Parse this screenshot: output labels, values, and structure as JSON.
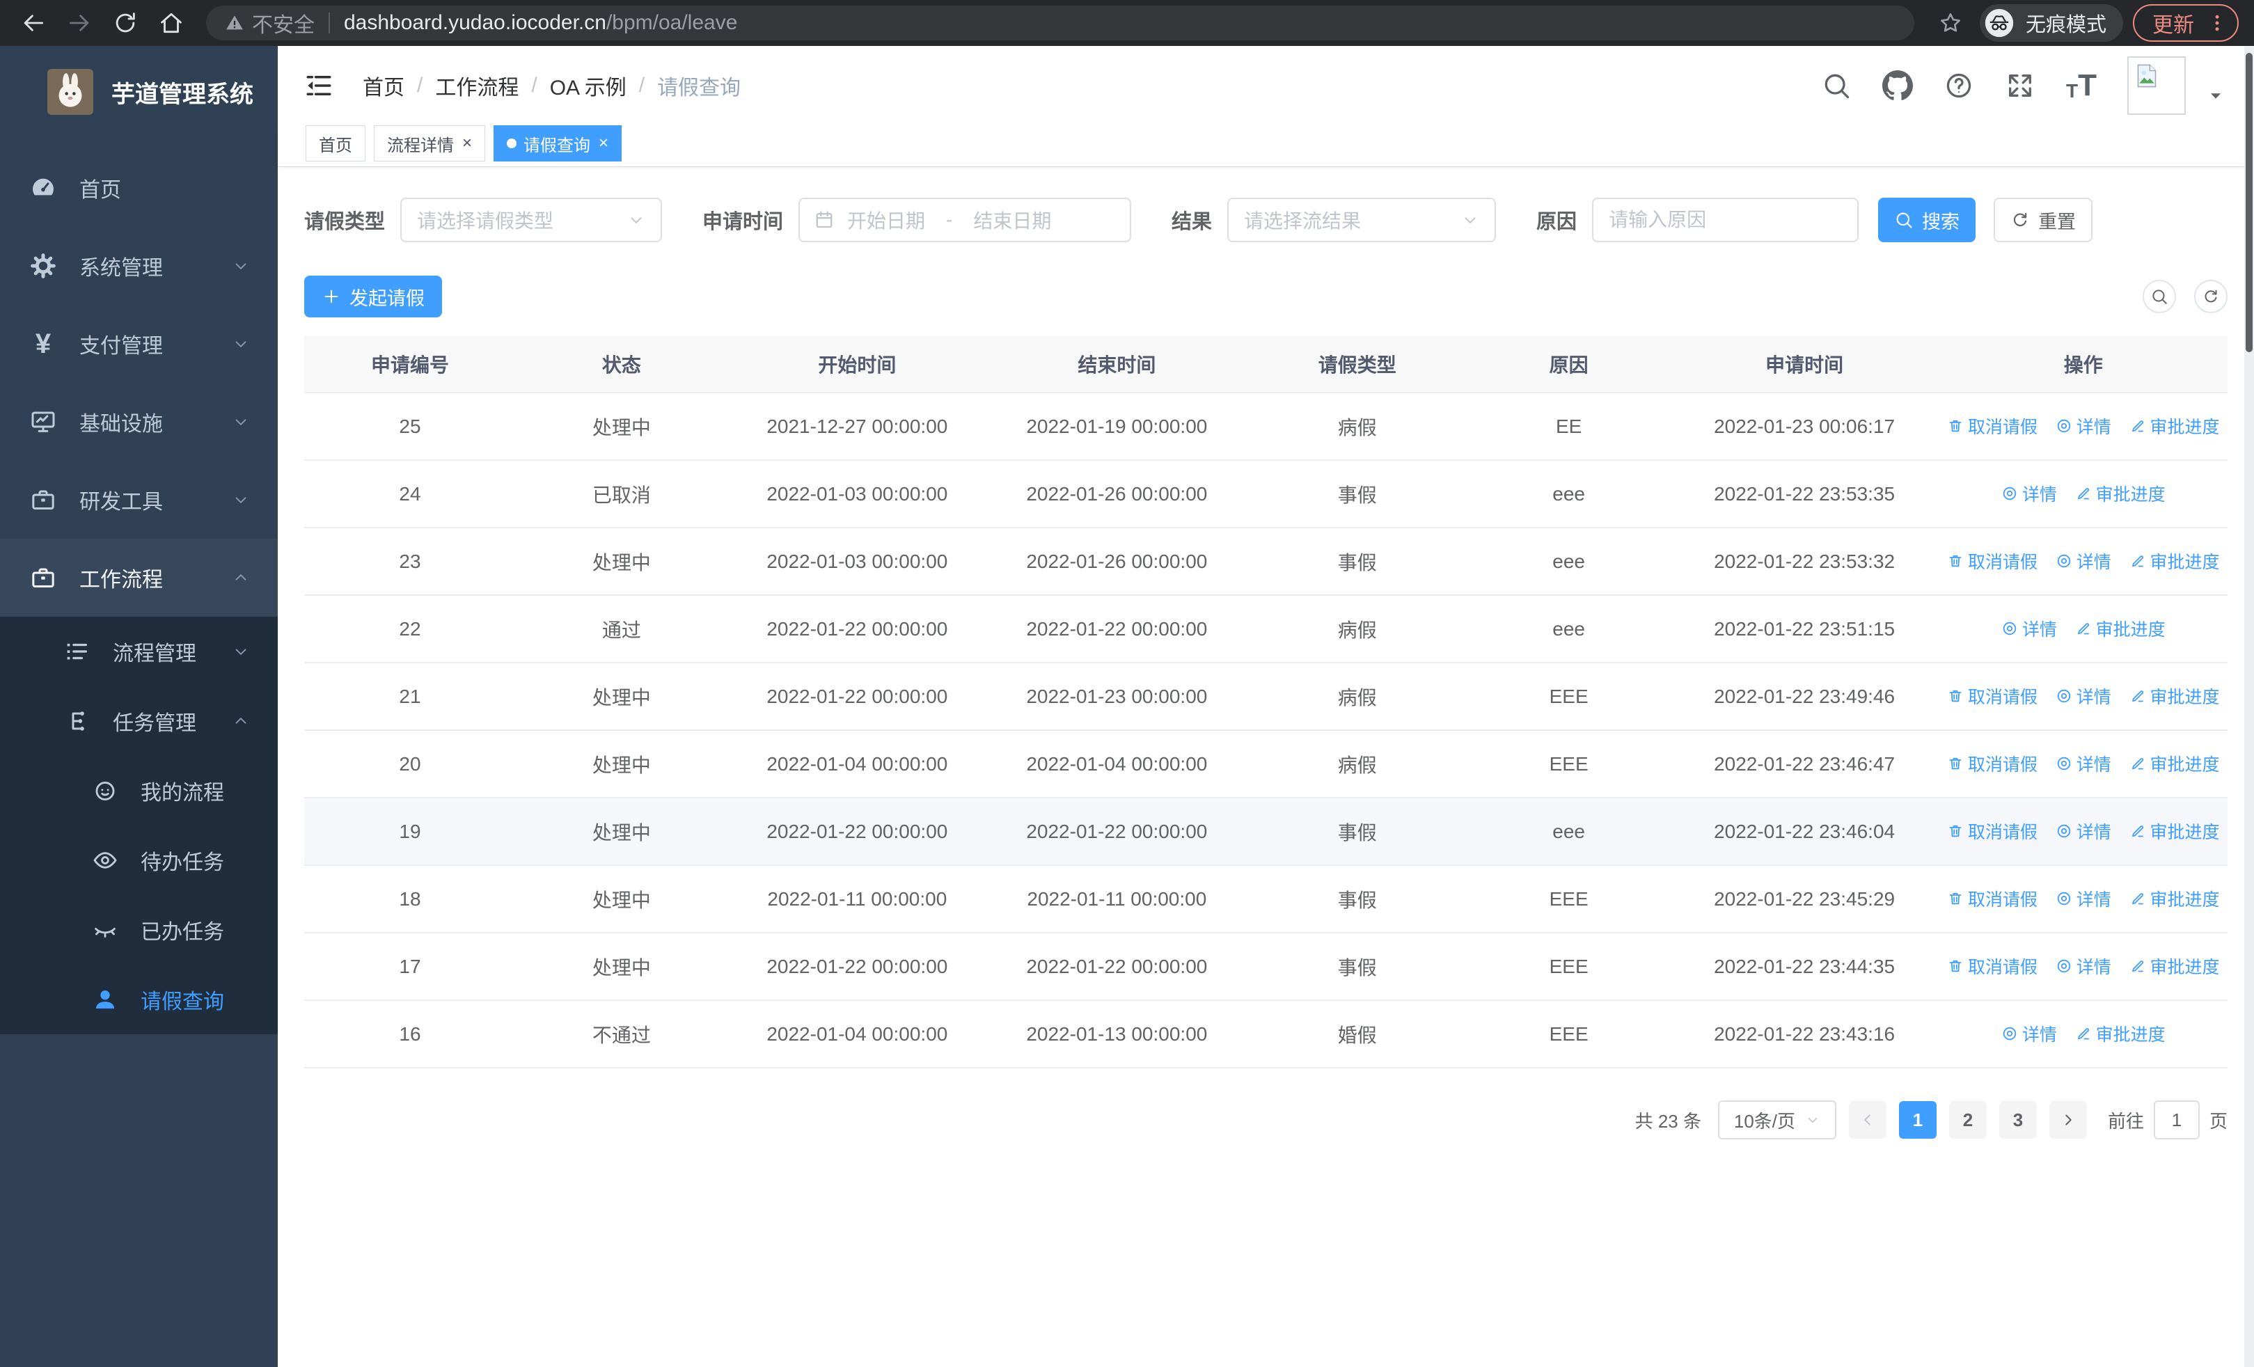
{
  "colors": {
    "accent": "#409eff",
    "sidebar_bg": "#304156",
    "submenu_bg": "#1f2d3d",
    "update_accent": "#ec8b82"
  },
  "browser": {
    "security_label": "不安全",
    "url_host": "dashboard.yudao.iocoder.cn",
    "url_path": "/bpm/oa/leave",
    "incognito_label": "无痕模式",
    "update_label": "更新"
  },
  "sidebar": {
    "title": "芋道管理系统",
    "items": [
      {
        "key": "home",
        "label": "首页",
        "icon": "dashboard",
        "level": 0,
        "chevron": null,
        "in_submenu": false,
        "open": false,
        "active": false
      },
      {
        "key": "system-mgmt",
        "label": "系统管理",
        "icon": "gear",
        "level": 0,
        "chevron": "down",
        "in_submenu": false,
        "open": false,
        "active": false
      },
      {
        "key": "payment-mgmt",
        "label": "支付管理",
        "icon": "yen",
        "level": 0,
        "chevron": "down",
        "in_submenu": false,
        "open": false,
        "active": false
      },
      {
        "key": "infrastructure",
        "label": "基础设施",
        "icon": "monitor",
        "level": 0,
        "chevron": "down",
        "in_submenu": false,
        "open": false,
        "active": false
      },
      {
        "key": "dev-tools",
        "label": "研发工具",
        "icon": "toolbox",
        "level": 0,
        "chevron": "down",
        "in_submenu": false,
        "open": false,
        "active": false
      },
      {
        "key": "workflow",
        "label": "工作流程",
        "icon": "briefcase",
        "level": 0,
        "chevron": "up",
        "in_submenu": false,
        "open": true,
        "active": false
      },
      {
        "key": "process-mgmt",
        "label": "流程管理",
        "icon": "list",
        "level": 1,
        "chevron": "down",
        "in_submenu": true,
        "open": false,
        "active": false
      },
      {
        "key": "task-mgmt",
        "label": "任务管理",
        "icon": "tree",
        "level": 1,
        "chevron": "up",
        "in_submenu": true,
        "open": false,
        "active": false
      },
      {
        "key": "my-process",
        "label": "我的流程",
        "icon": "face",
        "level": 2,
        "chevron": null,
        "in_submenu": true,
        "open": false,
        "active": false
      },
      {
        "key": "todo-tasks",
        "label": "待办任务",
        "icon": "eye-open",
        "level": 2,
        "chevron": null,
        "in_submenu": true,
        "open": false,
        "active": false
      },
      {
        "key": "done-tasks",
        "label": "已办任务",
        "icon": "eye-closed",
        "level": 2,
        "chevron": null,
        "in_submenu": true,
        "open": false,
        "active": false
      },
      {
        "key": "leave-query",
        "label": "请假查询",
        "icon": "user",
        "level": 2,
        "chevron": null,
        "in_submenu": true,
        "open": false,
        "active": true
      }
    ]
  },
  "topbar": {
    "breadcrumb": [
      "首页",
      "工作流程",
      "OA 示例",
      "请假查询"
    ]
  },
  "tabs": [
    {
      "key": "home",
      "label": "首页",
      "closable": false,
      "active": false
    },
    {
      "key": "process-detail",
      "label": "流程详情",
      "closable": true,
      "active": false
    },
    {
      "key": "leave-query",
      "label": "请假查询",
      "closable": true,
      "active": true
    }
  ],
  "filters": {
    "leave_type": {
      "label": "请假类型",
      "placeholder": "请选择请假类型"
    },
    "apply_time": {
      "label": "申请时间",
      "start_placeholder": "开始日期",
      "separator": "-",
      "end_placeholder": "结束日期"
    },
    "result": {
      "label": "结果",
      "placeholder": "请选择流结果"
    },
    "reason": {
      "label": "原因",
      "placeholder": "请输入原因"
    },
    "search_label": "搜索",
    "reset_label": "重置"
  },
  "toolbar": {
    "create_label": "发起请假"
  },
  "table": {
    "columns": [
      "申请编号",
      "状态",
      "开始时间",
      "结束时间",
      "请假类型",
      "原因",
      "申请时间",
      "操作"
    ],
    "action_labels": {
      "cancel": "取消请假",
      "detail": "详情",
      "progress": "审批进度"
    },
    "rows": [
      {
        "id": "25",
        "status": "处理中",
        "start": "2021-12-27 00:00:00",
        "end": "2022-01-19 00:00:00",
        "type": "病假",
        "reason": "EE",
        "apply": "2022-01-23 00:06:17",
        "can_cancel": true,
        "highlighted": false
      },
      {
        "id": "24",
        "status": "已取消",
        "start": "2022-01-03 00:00:00",
        "end": "2022-01-26 00:00:00",
        "type": "事假",
        "reason": "eee",
        "apply": "2022-01-22 23:53:35",
        "can_cancel": false,
        "highlighted": false
      },
      {
        "id": "23",
        "status": "处理中",
        "start": "2022-01-03 00:00:00",
        "end": "2022-01-26 00:00:00",
        "type": "事假",
        "reason": "eee",
        "apply": "2022-01-22 23:53:32",
        "can_cancel": true,
        "highlighted": false
      },
      {
        "id": "22",
        "status": "通过",
        "start": "2022-01-22 00:00:00",
        "end": "2022-01-22 00:00:00",
        "type": "病假",
        "reason": "eee",
        "apply": "2022-01-22 23:51:15",
        "can_cancel": false,
        "highlighted": false
      },
      {
        "id": "21",
        "status": "处理中",
        "start": "2022-01-22 00:00:00",
        "end": "2022-01-23 00:00:00",
        "type": "病假",
        "reason": "EEE",
        "apply": "2022-01-22 23:49:46",
        "can_cancel": true,
        "highlighted": false
      },
      {
        "id": "20",
        "status": "处理中",
        "start": "2022-01-04 00:00:00",
        "end": "2022-01-04 00:00:00",
        "type": "病假",
        "reason": "EEE",
        "apply": "2022-01-22 23:46:47",
        "can_cancel": true,
        "highlighted": false
      },
      {
        "id": "19",
        "status": "处理中",
        "start": "2022-01-22 00:00:00",
        "end": "2022-01-22 00:00:00",
        "type": "事假",
        "reason": "eee",
        "apply": "2022-01-22 23:46:04",
        "can_cancel": true,
        "highlighted": true
      },
      {
        "id": "18",
        "status": "处理中",
        "start": "2022-01-11 00:00:00",
        "end": "2022-01-11 00:00:00",
        "type": "事假",
        "reason": "EEE",
        "apply": "2022-01-22 23:45:29",
        "can_cancel": true,
        "highlighted": false
      },
      {
        "id": "17",
        "status": "处理中",
        "start": "2022-01-22 00:00:00",
        "end": "2022-01-22 00:00:00",
        "type": "事假",
        "reason": "EEE",
        "apply": "2022-01-22 23:44:35",
        "can_cancel": true,
        "highlighted": false
      },
      {
        "id": "16",
        "status": "不通过",
        "start": "2022-01-04 00:00:00",
        "end": "2022-01-13 00:00:00",
        "type": "婚假",
        "reason": "EEE",
        "apply": "2022-01-22 23:43:16",
        "can_cancel": false,
        "highlighted": false
      }
    ]
  },
  "pagination": {
    "total_label": "共 23 条",
    "page_size_label": "10条/页",
    "pages": [
      "1",
      "2",
      "3"
    ],
    "active_page": "1",
    "goto_label": "前往",
    "goto_value": "1",
    "page_unit": "页"
  }
}
